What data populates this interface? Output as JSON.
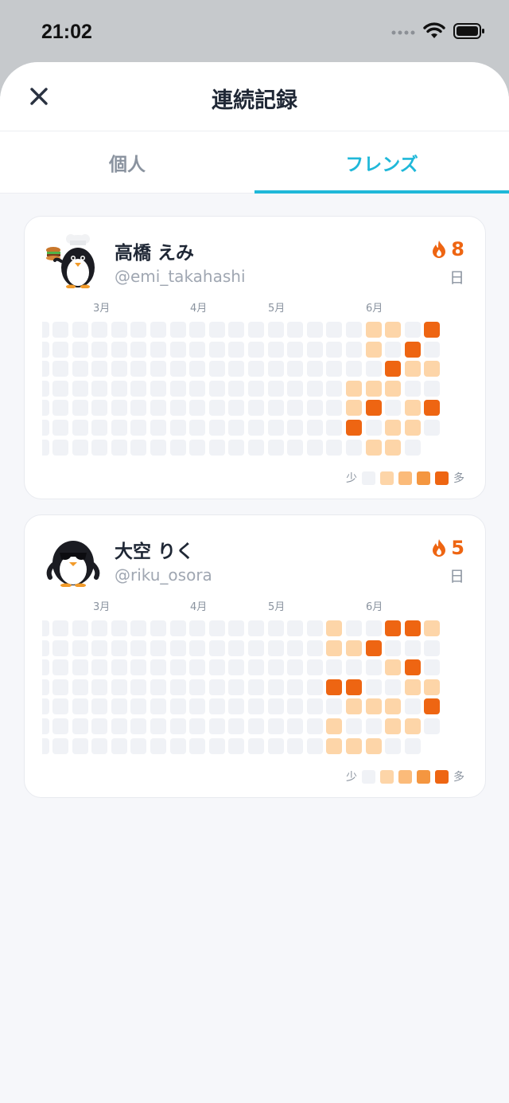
{
  "status": {
    "time": "21:02"
  },
  "header": {
    "title": "連続記録"
  },
  "tabs": [
    {
      "label": "個人",
      "active": false
    },
    {
      "label": "フレンズ",
      "active": true
    }
  ],
  "colors": {
    "accent": "#1fb8d9",
    "streak": "#ee6512",
    "levels": [
      "#f0f2f6",
      "#fdd5a8",
      "#fbbb7a",
      "#f49640",
      "#ee6512"
    ]
  },
  "friends": [
    {
      "name": "高橋 えみ",
      "handle": "@emi_takahashi",
      "streak": "8",
      "streak_unit": "日",
      "avatar_icon": "penguin-chef-icon",
      "months": [
        "3月",
        "4月",
        "5月",
        "6月"
      ],
      "legend": {
        "less": "少",
        "more": "多"
      },
      "activity_weeks": [
        [
          0,
          0,
          0,
          0,
          0,
          0,
          0
        ],
        [
          0,
          0,
          0,
          0,
          0,
          0,
          0
        ],
        [
          0,
          0,
          0,
          0,
          0,
          0,
          0
        ],
        [
          0,
          0,
          0,
          0,
          0,
          0,
          0
        ],
        [
          0,
          0,
          0,
          0,
          0,
          0,
          0
        ],
        [
          0,
          0,
          0,
          0,
          0,
          0,
          0
        ],
        [
          0,
          0,
          0,
          0,
          0,
          0,
          0
        ],
        [
          0,
          0,
          0,
          0,
          0,
          0,
          0
        ],
        [
          0,
          0,
          0,
          0,
          0,
          0,
          0
        ],
        [
          0,
          0,
          0,
          0,
          0,
          0,
          0
        ],
        [
          0,
          0,
          0,
          0,
          0,
          0,
          0
        ],
        [
          0,
          0,
          0,
          0,
          0,
          0,
          0
        ],
        [
          0,
          0,
          0,
          0,
          0,
          0,
          0
        ],
        [
          0,
          0,
          0,
          0,
          0,
          0,
          0
        ],
        [
          0,
          0,
          0,
          0,
          0,
          0,
          0
        ],
        [
          0,
          0,
          0,
          0,
          0,
          0,
          0
        ],
        [
          0,
          0,
          0,
          1,
          1,
          4,
          0
        ],
        [
          1,
          1,
          0,
          1,
          4,
          0,
          1
        ],
        [
          1,
          0,
          4,
          1,
          0,
          1,
          1
        ],
        [
          0,
          4,
          1,
          0,
          1,
          1,
          0
        ],
        [
          4,
          0,
          1,
          0,
          4,
          0,
          -1
        ]
      ]
    },
    {
      "name": "大空 りく",
      "handle": "@riku_osora",
      "streak": "5",
      "streak_unit": "日",
      "avatar_icon": "penguin-sunglasses-icon",
      "months": [
        "3月",
        "4月",
        "5月",
        "6月"
      ],
      "legend": {
        "less": "少",
        "more": "多"
      },
      "activity_weeks": [
        [
          0,
          0,
          0,
          0,
          0,
          0,
          0
        ],
        [
          0,
          0,
          0,
          0,
          0,
          0,
          0
        ],
        [
          0,
          0,
          0,
          0,
          0,
          0,
          0
        ],
        [
          0,
          0,
          0,
          0,
          0,
          0,
          0
        ],
        [
          0,
          0,
          0,
          0,
          0,
          0,
          0
        ],
        [
          0,
          0,
          0,
          0,
          0,
          0,
          0
        ],
        [
          0,
          0,
          0,
          0,
          0,
          0,
          0
        ],
        [
          0,
          0,
          0,
          0,
          0,
          0,
          0
        ],
        [
          0,
          0,
          0,
          0,
          0,
          0,
          0
        ],
        [
          0,
          0,
          0,
          0,
          0,
          0,
          0
        ],
        [
          0,
          0,
          0,
          0,
          0,
          0,
          0
        ],
        [
          0,
          0,
          0,
          0,
          0,
          0,
          0
        ],
        [
          0,
          0,
          0,
          0,
          0,
          0,
          0
        ],
        [
          0,
          0,
          0,
          0,
          0,
          0,
          0
        ],
        [
          0,
          0,
          0,
          0,
          0,
          0,
          0
        ],
        [
          1,
          1,
          0,
          4,
          0,
          1,
          1
        ],
        [
          0,
          1,
          0,
          4,
          1,
          0,
          1
        ],
        [
          0,
          4,
          0,
          0,
          1,
          0,
          1
        ],
        [
          4,
          0,
          1,
          0,
          1,
          1,
          0
        ],
        [
          4,
          0,
          4,
          1,
          0,
          1,
          0
        ],
        [
          1,
          0,
          0,
          1,
          4,
          0,
          -1
        ]
      ]
    }
  ]
}
